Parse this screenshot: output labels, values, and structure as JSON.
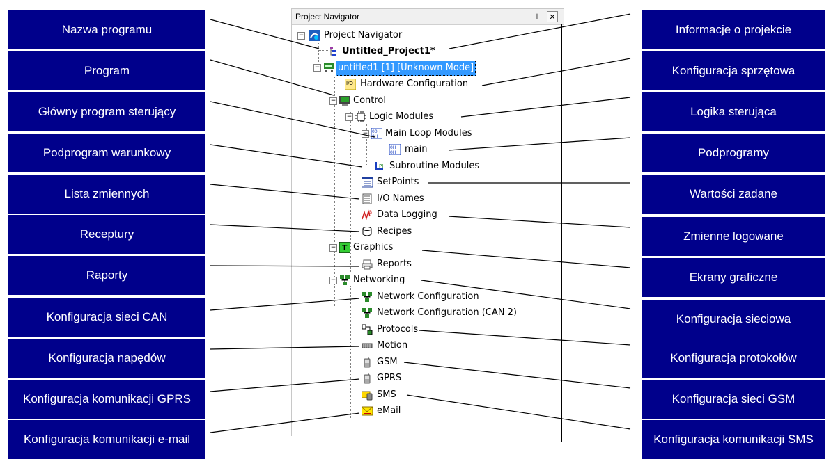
{
  "panel": {
    "title": "Project Navigator",
    "pin_glyph": "⊥",
    "close_glyph": "✕"
  },
  "tree": {
    "root": "Project Navigator",
    "project_info": "Untitled_Project1*",
    "program": "untitled1 [1] [Unknown Mode]",
    "hardware": "Hardware Configuration",
    "control": "Control",
    "logic_modules": "Logic Modules",
    "main_loop": "Main Loop Modules",
    "main": "main",
    "subroutine": "Subroutine Modules",
    "setpoints": "SetPoints",
    "io_names": "I/O Names",
    "data_logging": "Data Logging",
    "recipes": "Recipes",
    "graphics": "Graphics",
    "reports": "Reports",
    "networking": "Networking",
    "network_config": "Network Configuration",
    "network_config_can2": "Network Configuration (CAN 2)",
    "protocols": "Protocols",
    "motion": "Motion",
    "gsm": "GSM",
    "gprs": "GPRS",
    "sms": "SMS",
    "email": "eMail"
  },
  "callouts_left": [
    "Nazwa programu",
    "Program",
    "Główny  program sterujący",
    "Podprogram warunkowy",
    "Lista zmiennych",
    "Receptury",
    "Raporty",
    "Konfiguracja  sieci CAN",
    "Konfiguracja  napędów",
    "Konfiguracja komunikacji GPRS",
    "Konfiguracja komunikacji e-mail"
  ],
  "callouts_right": [
    "Informacje  o projekcie",
    "Konfiguracja sprzętowa",
    "Logika sterująca",
    "Podprogramy",
    "Wartości zadane",
    "Zmienne logowane",
    "Ekrany graficzne",
    "Konfiguracja  sieciowa",
    "Konfiguracja  protokołów",
    "Konfiguracja sieci GSM",
    "Konfiguracja komunikacji SMS"
  ],
  "colors": {
    "callout_bg": "#00008b",
    "callout_text": "#ffffff",
    "selection": "#3399ff"
  }
}
